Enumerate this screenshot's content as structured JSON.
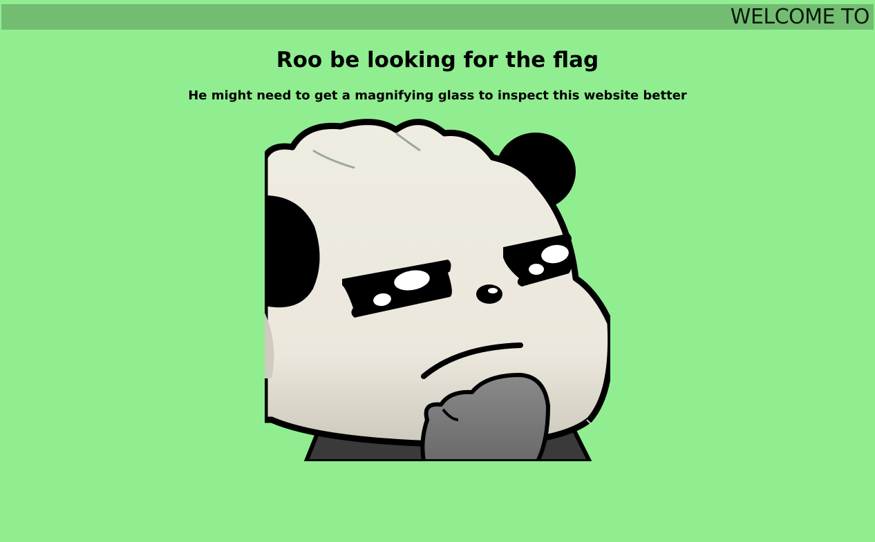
{
  "marquee": {
    "text": "WELCOME TO",
    "bar_color": "#73bd73"
  },
  "page": {
    "title": "Roo be looking for the flag",
    "subtitle": "He might need to get a magnifying glass to inspect this website better",
    "background": "#90ee90"
  },
  "image": {
    "icon": "thinking-panda-image"
  }
}
